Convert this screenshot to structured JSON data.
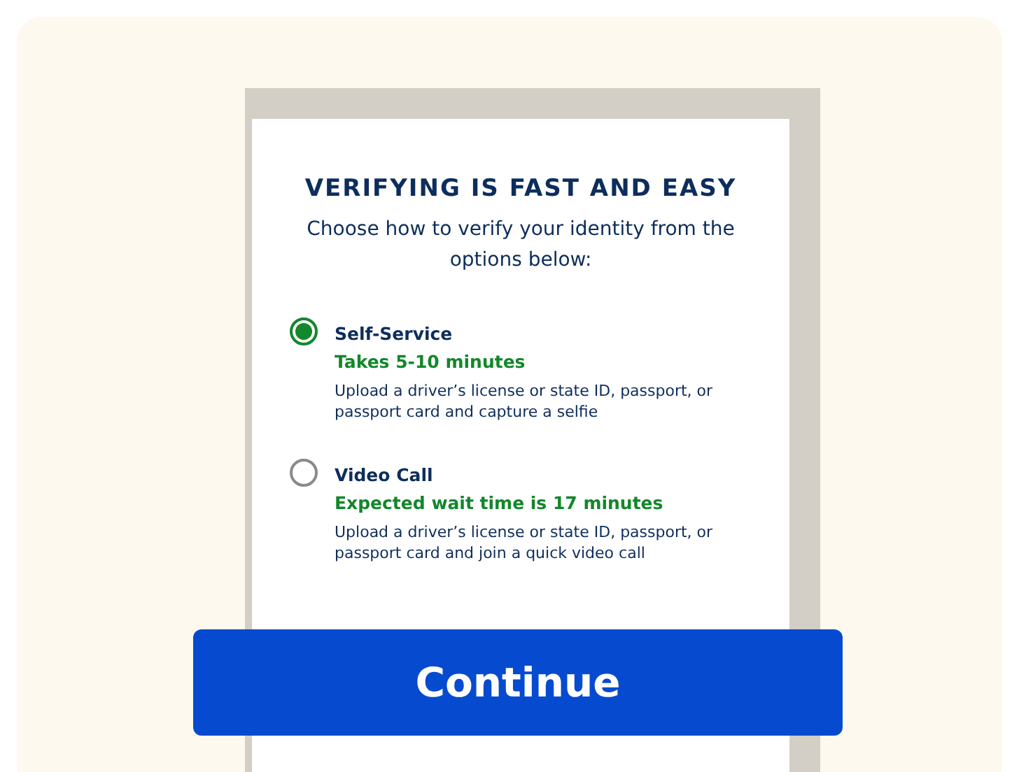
{
  "heading": "VERIFYING IS FAST AND EASY",
  "subheading": "Choose how to verify your identity from the options below:",
  "options": [
    {
      "title": "Self-Service",
      "time": "Takes 5-10 minutes",
      "description": "Upload a driver’s license or state ID, passport, or passport card and capture a selfie",
      "selected": true
    },
    {
      "title": "Video Call",
      "time": "Expected wait time is 17 minutes",
      "description": "Upload a driver’s license or state ID, passport, or passport card and join a quick video call",
      "selected": false
    }
  ],
  "button": "Continue"
}
